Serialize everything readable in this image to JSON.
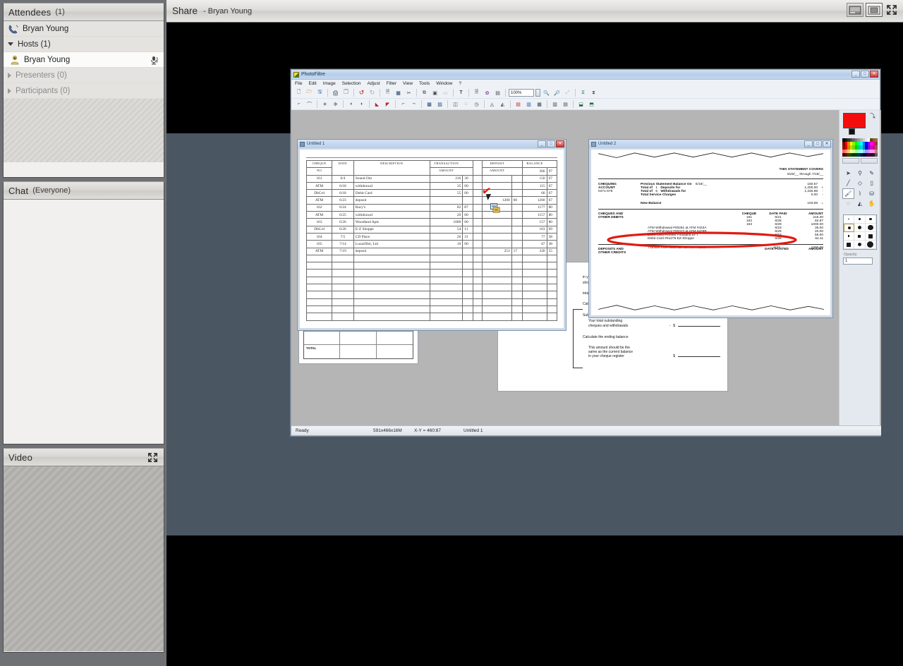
{
  "sidebar": {
    "attendees": {
      "title": "Attendees",
      "count": "(1)",
      "phone_user": "Bryan Young",
      "groups": [
        {
          "label": "Hosts (1)",
          "expanded": true,
          "members": [
            "Bryan Young"
          ]
        },
        {
          "label": "Presenters (0)",
          "expanded": false,
          "members": []
        },
        {
          "label": "Participants (0)",
          "expanded": false,
          "members": []
        }
      ]
    },
    "chat": {
      "title": "Chat",
      "scope": "(Everyone)",
      "messages": []
    },
    "video": {
      "title": "Video",
      "expand_icon": "expand-icon"
    }
  },
  "share": {
    "title": "Share",
    "presenter": "- Bryan Young",
    "view_buttons": [
      {
        "name": "fit-width-view",
        "selected": false
      },
      {
        "name": "fit-page-view",
        "selected": true
      },
      {
        "name": "full-screen",
        "selected": false
      }
    ]
  },
  "photofiltre": {
    "window_title": "PhotoFiltre",
    "menu": [
      "File",
      "Edit",
      "Image",
      "Selection",
      "Adjust",
      "Filter",
      "View",
      "Tools",
      "Window",
      "?"
    ],
    "zoom_value": "100%",
    "window_buttons": {
      "minimize": "_",
      "maximize": "□",
      "close": "✕"
    },
    "status_bar": {
      "state": "Ready",
      "dimensions": "591x466x16M",
      "coordinates": "X-Y = 460:87",
      "document": "Untitled 1"
    },
    "tool_panel": {
      "primary_color": "#f40d0d",
      "secondary_color": "#111111",
      "opacity_value": "1",
      "opacity_label": "Opacity",
      "tools": [
        "pointer-tool",
        "eyedropper-tool",
        "magic-wand-tool",
        "line-tool",
        "eraser-tool",
        "stamp-tool",
        "brush-tool",
        "smudge-tool",
        "bucket-tool",
        "blur-tool",
        "sharpen-tool",
        "hand-tool"
      ],
      "brushes": [
        "brush-xs",
        "brush-s",
        "brush-m",
        "brush-dot-1",
        "brush-dot-2",
        "brush-dot-3",
        "brush-sq-1",
        "brush-sq-2",
        "brush-sq-3",
        "brush-big-1",
        "brush-big-2",
        "brush-big-3"
      ]
    },
    "documents": [
      {
        "title": "Untitled 1",
        "name": "cheque-register-document"
      },
      {
        "title": "Untitled 2",
        "name": "bank-statement-document"
      }
    ]
  },
  "cheque_register": {
    "headers": [
      "CHEQUE NO",
      "DATE",
      "DESCRIPTION",
      "TRANSACTION AMOUNT",
      "✓",
      "DEPOSIT AMOUNT",
      "BALANCE"
    ],
    "opening_balance": {
      "dollars": "366",
      "cents": "97"
    },
    "rows": [
      {
        "no": "161",
        "date": "6/4",
        "desc": "Sound Out",
        "tx": "216",
        "tx_c": "30",
        "dep": "",
        "dep_c": "",
        "bal": "150",
        "bal_c": "67"
      },
      {
        "no": "ATM",
        "date": "6/18",
        "desc": "withdrawal",
        "tx": "35",
        "tx_c": "00",
        "dep": "",
        "dep_c": "",
        "bal": "115",
        "bal_c": "67"
      },
      {
        "no": "DbCrd",
        "date": "6/18",
        "desc": "Debit Card",
        "tx": "55",
        "tx_c": "00",
        "dep": "",
        "dep_c": "",
        "bal": "60",
        "bal_c": "67"
      },
      {
        "no": "ATM",
        "date": "6/23",
        "desc": "deposit",
        "tx": "",
        "tx_c": "",
        "dep": "1200",
        "dep_c": "00",
        "bal": "1260",
        "bal_c": "67"
      },
      {
        "no": "162",
        "date": "6/24",
        "desc": "Racy's",
        "tx": "82",
        "tx_c": "87",
        "dep": "",
        "dep_c": "",
        "bal": "1177",
        "bal_c": "80"
      },
      {
        "no": "ATM",
        "date": "6/25",
        "desc": "withdrawal",
        "tx": "20",
        "tx_c": "00",
        "dep": "",
        "dep_c": "",
        "bal": "1157",
        "bal_c": "80"
      },
      {
        "no": "163",
        "date": "6/26",
        "desc": "Woodland Apts",
        "tx": "1000",
        "tx_c": "00",
        "dep": "",
        "dep_c": "",
        "bal": "157",
        "bal_c": "80"
      },
      {
        "no": "DbCrd",
        "date": "6/26",
        "desc": "E-Z Shoppe",
        "tx": "54",
        "tx_c": "11",
        "dep": "",
        "dep_c": "",
        "bal": "103",
        "bal_c": "69"
      },
      {
        "no": "164",
        "date": "7/5",
        "desc": "CD Place",
        "tx": "26",
        "tx_c": "31",
        "dep": "",
        "dep_c": "",
        "bal": "77",
        "bal_c": "38"
      },
      {
        "no": "165",
        "date": "7/14",
        "desc": "Lucasfilm, Ltd",
        "tx": "10",
        "tx_c": "00",
        "dep": "",
        "dep_c": "",
        "bal": "67",
        "bal_c": "38"
      },
      {
        "no": "ATM",
        "date": "7/19",
        "desc": "deposit",
        "tx": "",
        "tx_c": "",
        "dep": "253",
        "dep_c": "17",
        "bal": "320",
        "bal_c": "55"
      }
    ],
    "blank_rows": 9,
    "annotation": "red-check-mark"
  },
  "bank_statement": {
    "covers_label": "THIS STATEMENT COVERS",
    "covers_range": "6/20/__ through 7/19/__",
    "account_label_1": "CHEQUING",
    "account_label_2": "ACCOUNT",
    "account_number": "0471-678",
    "summary": [
      {
        "label": "Previous Statement Balance On",
        "extra": "6/19/__",
        "amount": "150.67",
        "sign": ""
      },
      {
        "label": "Total of",
        "count": "1",
        "label2": "Deposits for",
        "amount": "1,200.00",
        "sign": "+"
      },
      {
        "label": "Total of",
        "count": "6",
        "label2": "Withdrawals for",
        "amount": "1,246.98",
        "sign": "-"
      },
      {
        "label": "Total Service Charges",
        "extra": "",
        "amount": "0.00",
        "sign": "-"
      }
    ],
    "new_balance_label": "New Balance",
    "new_balance_amount": "103.69",
    "new_balance_sign": "=",
    "debits_label_1": "CHEQUES AND",
    "debits_label_2": "OTHER DEBITS",
    "debits_headers": [
      "CHEQUE",
      "DATE PAID",
      "AMOUNT"
    ],
    "debits": [
      {
        "desc": "",
        "cheque": "161",
        "date": "6/21",
        "amount": "216.30"
      },
      {
        "desc": "",
        "cheque": "162",
        "date": "6/26",
        "amount": "82.87"
      },
      {
        "desc": "",
        "cheque": "163",
        "date": "6/29",
        "amount": "1000.00"
      },
      {
        "desc": "ATM Withdrawal #00281 at ATM #423A",
        "cheque": "",
        "date": "6/18",
        "amount": "35.00",
        "circled": true
      },
      {
        "desc": "ATM Withdrawal #00322 at ATM #429B",
        "cheque": "",
        "date": "6/25",
        "amount": "20.00"
      },
      {
        "desc": "Debit Card #00588 Foodland EFT",
        "cheque": "",
        "date": "6/18",
        "amount": "55.00"
      },
      {
        "desc": "Debit Card #01275 EZ-Shoppe",
        "cheque": "",
        "date": "6/26",
        "amount": "54.11"
      }
    ],
    "credits_label_1": "DEPOSITS AND",
    "credits_label_2": "OTHER CREDITS",
    "credits_headers": [
      "DATE POSTED",
      "AMOUNT"
    ],
    "credits": [
      {
        "desc": "Transfer from 4039-557 at ATM #423C",
        "date": "6/23",
        "amount": "1200.00"
      }
    ],
    "annotation": "red-ellipse"
  },
  "worksheet": {
    "lines": [
      "in your register that are not",
      "shown on your statement"
    ],
    "total_label": "total",
    "subtotal_label": "Calculate the subtotal",
    "subtract_label": "Subtract",
    "subtract_lines": [
      "Your total outstanding",
      "cheques and withdrawals"
    ],
    "ending_label": "Calculate the ending balance",
    "note_lines": [
      "This amount should be the",
      "same as the current balance",
      "in your cheque register"
    ],
    "dollar": "$",
    "plus": "+",
    "minus": "-",
    "table_total_label": "TOTAL"
  },
  "colors": {
    "desktop": "#4a5662",
    "letterbox": "#000000",
    "sidebar_bg": "#6f7175",
    "panel_bg": "#f1f0ee",
    "accent_red": "#e01b10"
  }
}
